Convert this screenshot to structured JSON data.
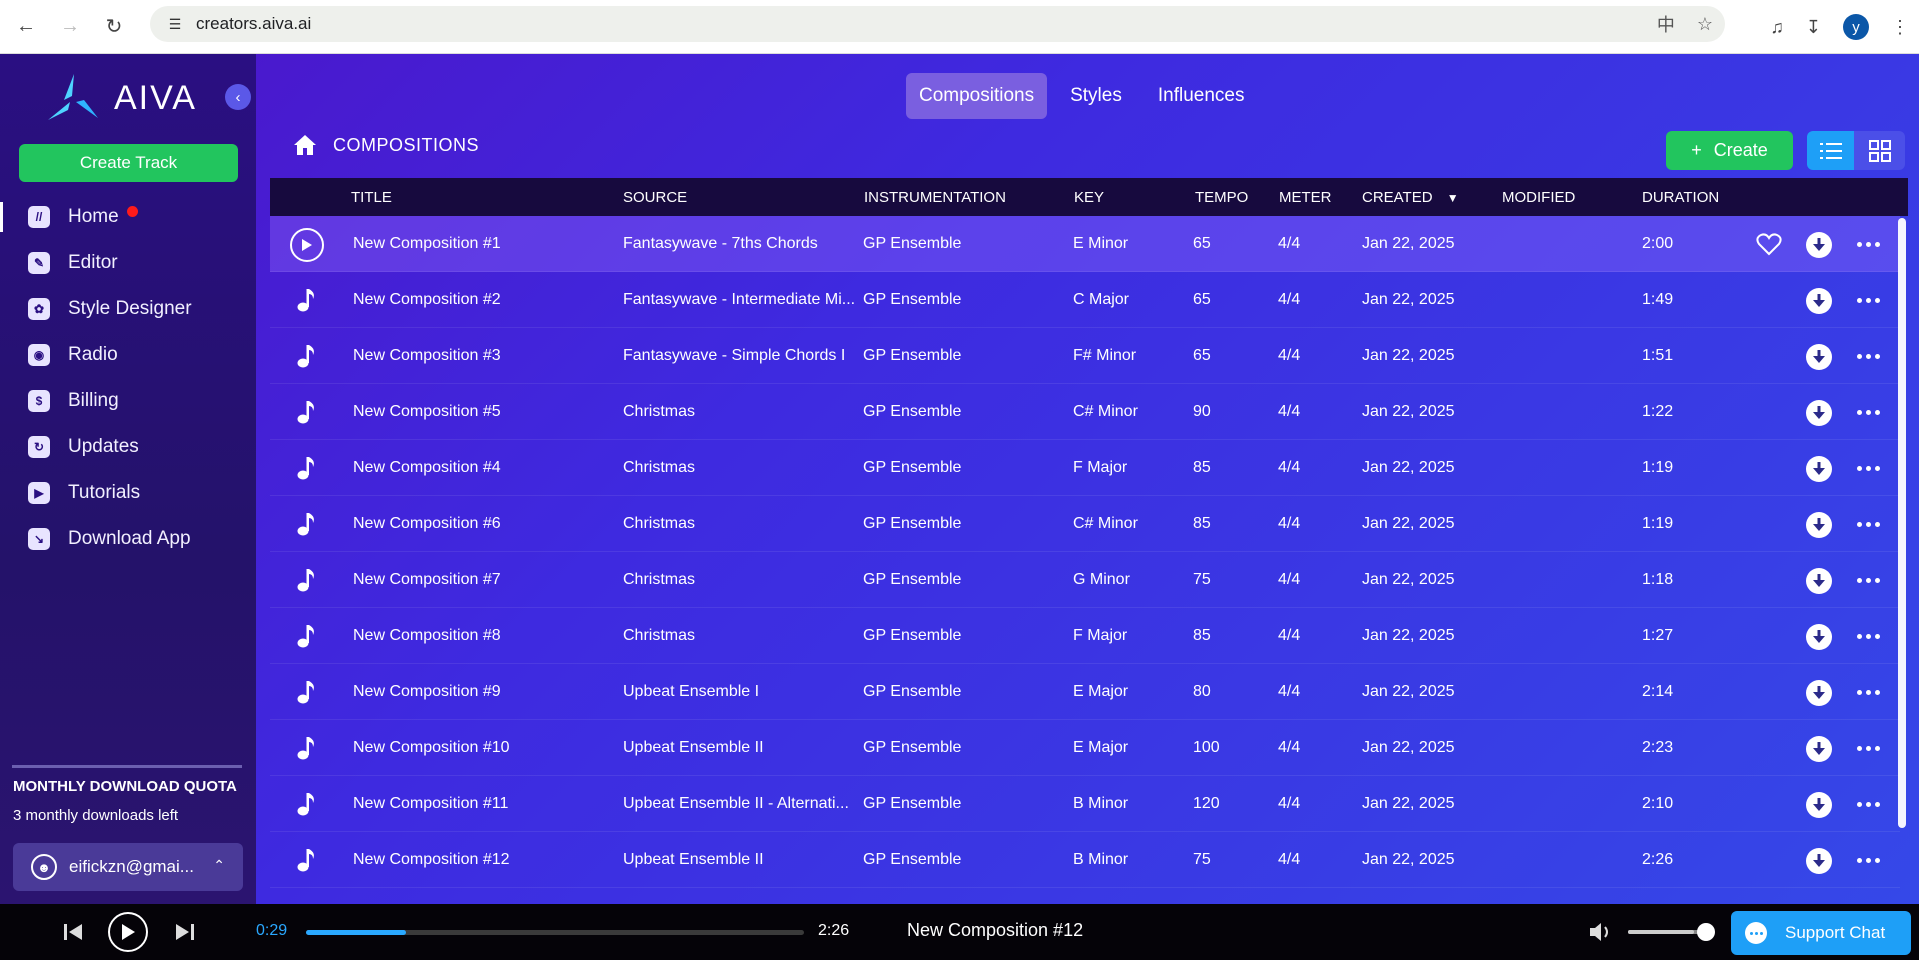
{
  "browser": {
    "url": "creators.aiva.ai",
    "profile_initial": "y"
  },
  "sidebar": {
    "logo_text": "AIVA",
    "create_track_label": "Create Track",
    "items": [
      {
        "label": "Home",
        "icon": "home-icon",
        "active": true,
        "notification": true
      },
      {
        "label": "Editor",
        "icon": "pencil-icon"
      },
      {
        "label": "Style Designer",
        "icon": "style-icon"
      },
      {
        "label": "Radio",
        "icon": "radio-icon"
      },
      {
        "label": "Billing",
        "icon": "dollar-icon"
      },
      {
        "label": "Updates",
        "icon": "refresh-icon"
      },
      {
        "label": "Tutorials",
        "icon": "play-icon"
      },
      {
        "label": "Download App",
        "icon": "download-app-icon"
      }
    ],
    "quota_title": "MONTHLY DOWNLOAD QUOTA",
    "quota_text": "3 monthly downloads left",
    "account_email": "eifickzn@gmai..."
  },
  "tabs": [
    {
      "label": "Compositions",
      "active": true
    },
    {
      "label": "Styles"
    },
    {
      "label": "Influences"
    }
  ],
  "breadcrumb": "COMPOSITIONS",
  "toolbar": {
    "create_label": "Create",
    "create_prefix": "+"
  },
  "table": {
    "columns": {
      "title": "TITLE",
      "source": "SOURCE",
      "instrumentation": "INSTRUMENTATION",
      "key": "KEY",
      "tempo": "TEMPO",
      "meter": "METER",
      "created": "CREATED",
      "modified": "MODIFIED",
      "duration": "DURATION"
    },
    "sort_column": "created",
    "rows": [
      {
        "title": "New Composition #1",
        "source": "Fantasywave - 7ths Chords",
        "instrumentation": "GP Ensemble",
        "key": "E Minor",
        "tempo": "65",
        "meter": "4/4",
        "created": "Jan 22, 2025",
        "modified": "",
        "duration": "2:00"
      },
      {
        "title": "New Composition #2",
        "source": "Fantasywave - Intermediate Mi...",
        "instrumentation": "GP Ensemble",
        "key": "C Major",
        "tempo": "65",
        "meter": "4/4",
        "created": "Jan 22, 2025",
        "modified": "",
        "duration": "1:49"
      },
      {
        "title": "New Composition #3",
        "source": "Fantasywave - Simple Chords I",
        "instrumentation": "GP Ensemble",
        "key": "F# Minor",
        "tempo": "65",
        "meter": "4/4",
        "created": "Jan 22, 2025",
        "modified": "",
        "duration": "1:51"
      },
      {
        "title": "New Composition #5",
        "source": "Christmas",
        "instrumentation": "GP Ensemble",
        "key": "C# Minor",
        "tempo": "90",
        "meter": "4/4",
        "created": "Jan 22, 2025",
        "modified": "",
        "duration": "1:22"
      },
      {
        "title": "New Composition #4",
        "source": "Christmas",
        "instrumentation": "GP Ensemble",
        "key": "F Major",
        "tempo": "85",
        "meter": "4/4",
        "created": "Jan 22, 2025",
        "modified": "",
        "duration": "1:19"
      },
      {
        "title": "New Composition #6",
        "source": "Christmas",
        "instrumentation": "GP Ensemble",
        "key": "C# Minor",
        "tempo": "85",
        "meter": "4/4",
        "created": "Jan 22, 2025",
        "modified": "",
        "duration": "1:19"
      },
      {
        "title": "New Composition #7",
        "source": "Christmas",
        "instrumentation": "GP Ensemble",
        "key": "G Minor",
        "tempo": "75",
        "meter": "4/4",
        "created": "Jan 22, 2025",
        "modified": "",
        "duration": "1:18"
      },
      {
        "title": "New Composition #8",
        "source": "Christmas",
        "instrumentation": "GP Ensemble",
        "key": "F Major",
        "tempo": "85",
        "meter": "4/4",
        "created": "Jan 22, 2025",
        "modified": "",
        "duration": "1:27"
      },
      {
        "title": "New Composition #9",
        "source": "Upbeat Ensemble I",
        "instrumentation": "GP Ensemble",
        "key": "E Major",
        "tempo": "80",
        "meter": "4/4",
        "created": "Jan 22, 2025",
        "modified": "",
        "duration": "2:14"
      },
      {
        "title": "New Composition #10",
        "source": "Upbeat Ensemble II",
        "instrumentation": "GP Ensemble",
        "key": "E Major",
        "tempo": "100",
        "meter": "4/4",
        "created": "Jan 22, 2025",
        "modified": "",
        "duration": "2:23"
      },
      {
        "title": "New Composition #11",
        "source": "Upbeat Ensemble II - Alternati...",
        "instrumentation": "GP Ensemble",
        "key": "B Minor",
        "tempo": "120",
        "meter": "4/4",
        "created": "Jan 22, 2025",
        "modified": "",
        "duration": "2:10"
      },
      {
        "title": "New Composition #12",
        "source": "Upbeat Ensemble II",
        "instrumentation": "GP Ensemble",
        "key": "B Minor",
        "tempo": "75",
        "meter": "4/4",
        "created": "Jan 22, 2025",
        "modified": "",
        "duration": "2:26"
      }
    ]
  },
  "player": {
    "current_time": "0:29",
    "duration": "2:26",
    "progress_fraction": 0.2,
    "track_title": "New Composition #12",
    "volume_fraction": 0.85
  },
  "support_chat_label": "Support Chat",
  "colors": {
    "accent_green": "#22c55e",
    "accent_blue": "#1e9ff7",
    "notification_red": "#ff1b1b"
  }
}
